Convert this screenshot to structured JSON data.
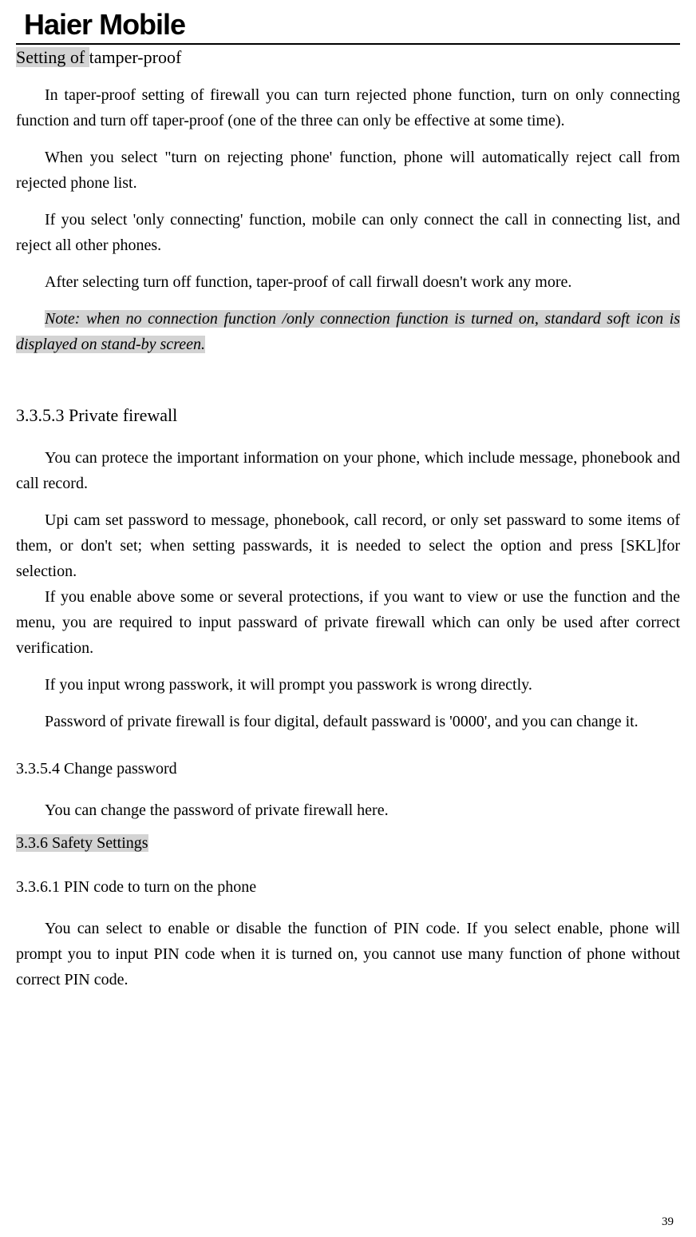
{
  "logo": {
    "brand": "Haier",
    "suffix": "Mobile"
  },
  "heading": {
    "prefix": "Setting of ",
    "rest": "tamper-proof"
  },
  "p1": "In taper-proof setting of firewall you can turn rejected phone function, turn on only connecting function and turn off taper-proof (one of the three can only be effective at some time).",
  "p2": "When you select \"turn on rejecting phone' function, phone will automatically reject call from rejected phone list.",
  "p3": "If you select 'only connecting' function, mobile can only connect the call in connecting list, and reject all other phones.",
  "p4": "After selecting turn off function, taper-proof of call firwall doesn't work any more.",
  "note1": "Note: when no connection function /only connection function is turned on, standard soft icon is displayed on stand-by screen.  ",
  "h3353": "3.3.5.3 Private firewall",
  "p5": "You can protece the important information on your phone, which include message, phonebook and call record.",
  "p6": "Upi cam set password to message, phonebook, call record, or only set passward to some items of them, or don't set; when setting passwards, it is needed to select the option and press [SKL]for selection.",
  "p7": "If you enable above some or several protections, if you want to view or use the function and the menu, you are required to input passward of private firewall which can only be used after correct verification.",
  "p8": "If you input wrong passwork, it will prompt you passwork is wrong directly.",
  "p9": "Password of private firewall is four digital, default passward is '0000', and you can change it.",
  "h3354": "3.3.5.4 Change password",
  "p10": " You can change the password of private firewall here.",
  "h336": "3.3.6 Safety Settings",
  "h3361": "3.3.6.1 PIN code to turn on the phone",
  "p11": "You can select to enable or disable the function of PIN code. If you select enable, phone will prompt you to input PIN code when it is turned on, you cannot use many function of phone without correct PIN code.",
  "page_number": "39"
}
